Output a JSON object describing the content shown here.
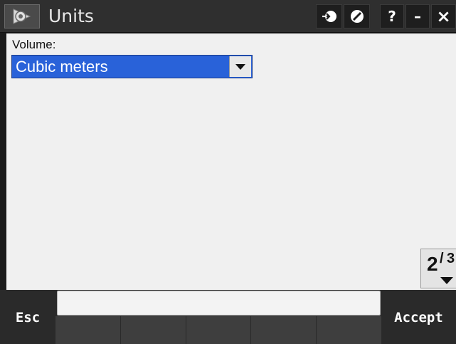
{
  "window": {
    "title": "Units",
    "app_icon": "settings-app-icon",
    "buttons": {
      "login_icon": "login-arrow-icon",
      "block_icon": "no-entry-icon",
      "help_label": "?",
      "minimize_label": "–",
      "close_label": "×"
    }
  },
  "form": {
    "volume_label": "Volume:",
    "volume_value": "Cubic meters"
  },
  "pager": {
    "current": "2",
    "separator": "/",
    "total": "3"
  },
  "footer": {
    "esc_label": "Esc",
    "accept_label": "Accept"
  },
  "colors": {
    "selection": "#2962d9",
    "titlebar": "#2f2f2f",
    "content_bg": "#f0f0f0"
  }
}
